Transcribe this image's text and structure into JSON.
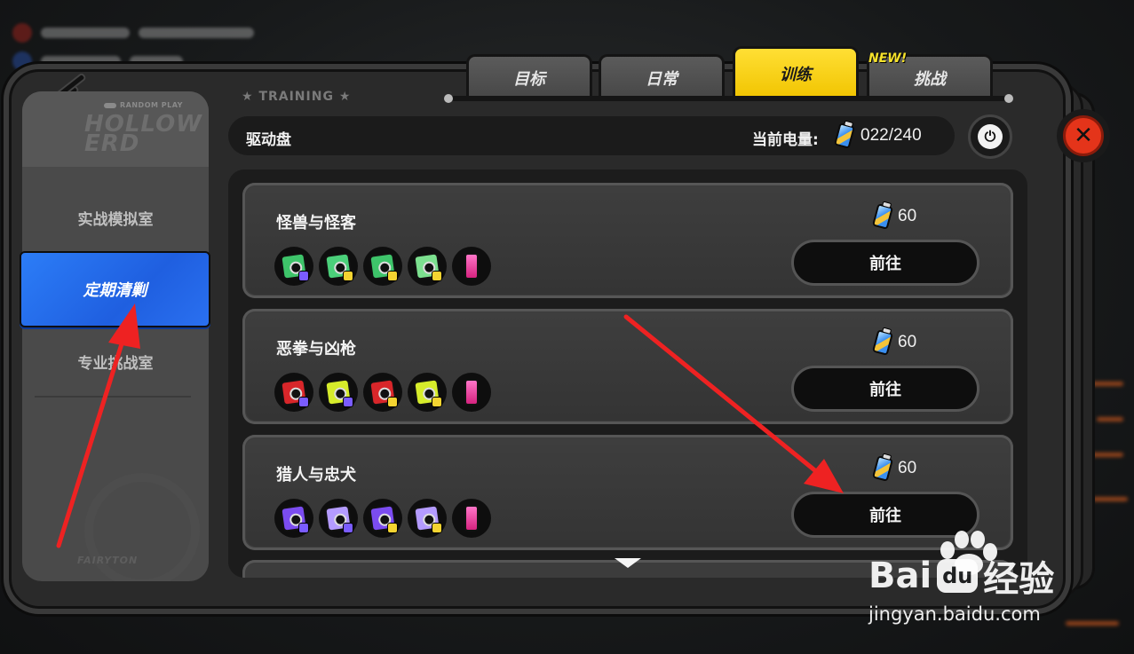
{
  "colors": {
    "accent_yellow": "#f5c400",
    "active_blue": "#2a72f5",
    "close_red": "#e4341a",
    "annotation_red": "#ee2222"
  },
  "sidebar": {
    "logo_small": "RANDOM PLAY",
    "logo": "HOLLOW ERD",
    "items": [
      {
        "label": "实战模拟室",
        "active": false
      },
      {
        "label": "定期清剿",
        "active": true
      },
      {
        "label": "专业挑战室",
        "active": false
      }
    ],
    "footer_logo": "FAIRYTON"
  },
  "section_label": "TRAINING",
  "tabs": [
    {
      "label": "目标",
      "active": false
    },
    {
      "label": "日常",
      "active": false
    },
    {
      "label": "训练",
      "active": true
    },
    {
      "label": "挑战",
      "active": false,
      "badge": "NEW!"
    }
  ],
  "header": {
    "title": "驱动盘",
    "power_label": "当前电量:",
    "power_value": "022/240",
    "battery_icon": "battery-icon"
  },
  "cards": [
    {
      "title": "怪兽与怪客",
      "cost": "60",
      "button": "前往",
      "drops": [
        {
          "color": "#3ec46a",
          "tag": "#7a5cff"
        },
        {
          "color": "#4bd07a",
          "tag": "#f4d431"
        },
        {
          "color": "#3ec46a",
          "tag": "#f4d431"
        },
        {
          "color": "#7ce08f",
          "tag": "#f4d431"
        },
        {
          "type": "can"
        }
      ]
    },
    {
      "title": "恶拳与凶枪",
      "cost": "60",
      "button": "前往",
      "drops": [
        {
          "color": "#d8262a",
          "tag": "#7a5cff"
        },
        {
          "color": "#d6ec2b",
          "tag": "#7a5cff"
        },
        {
          "color": "#d8262a",
          "tag": "#f4d431"
        },
        {
          "color": "#d6ec2b",
          "tag": "#f4d431"
        },
        {
          "type": "can"
        }
      ]
    },
    {
      "title": "猎人与忠犬",
      "cost": "60",
      "button": "前往",
      "drops": [
        {
          "color": "#7b4cf0",
          "tag": "#7a5cff"
        },
        {
          "color": "#b49bff",
          "tag": "#7a5cff"
        },
        {
          "color": "#7b4cf0",
          "tag": "#f4d431"
        },
        {
          "color": "#b49bff",
          "tag": "#f4d431"
        },
        {
          "type": "can"
        }
      ]
    }
  ],
  "watermark": {
    "brand_left": "Bai",
    "brand_du": "du",
    "brand_right": "经验",
    "url": "jingyan.baidu.com"
  }
}
